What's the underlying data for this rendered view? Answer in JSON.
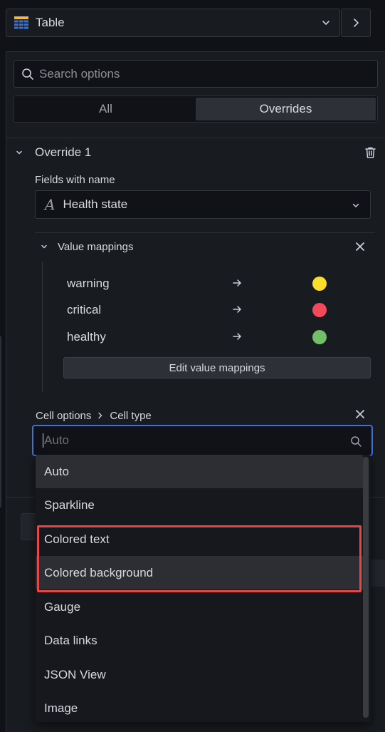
{
  "viz_picker": {
    "name": "Table",
    "icon": "table-icon"
  },
  "search": {
    "placeholder": "Search options"
  },
  "tabs": [
    {
      "label": "All",
      "active": false
    },
    {
      "label": "Overrides",
      "active": true
    }
  ],
  "override": {
    "title": "Override 1",
    "matcher_label": "Fields with name",
    "matcher_value": "Health state",
    "value_mappings": {
      "title": "Value mappings",
      "rows": [
        {
          "value": "warning",
          "color": "#fade2a"
        },
        {
          "value": "critical",
          "color": "#f2495c"
        },
        {
          "value": "healthy",
          "color": "#73bf69"
        }
      ],
      "edit_label": "Edit value mappings"
    },
    "cell_options": {
      "crumb_parent": "Cell options",
      "crumb_child": "Cell type",
      "input_placeholder": "Auto"
    }
  },
  "dropdown": {
    "items": [
      {
        "label": "Auto",
        "highlighted": true
      },
      {
        "label": "Sparkline",
        "highlighted": false
      },
      {
        "label": "Colored text",
        "highlighted": false
      },
      {
        "label": "Colored background",
        "highlighted": true
      },
      {
        "label": "Gauge",
        "highlighted": false
      },
      {
        "label": "Data links",
        "highlighted": false
      },
      {
        "label": "JSON View",
        "highlighted": false
      },
      {
        "label": "Image",
        "highlighted": false
      }
    ],
    "annotation_color": "#e24848"
  },
  "colors": {
    "focus_border": "#3d71d9",
    "panel_bg": "#181b1f",
    "page_bg": "#111217"
  }
}
